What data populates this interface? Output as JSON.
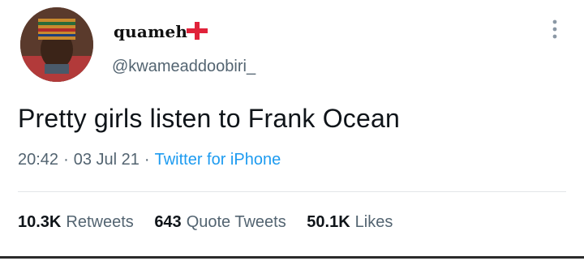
{
  "user": {
    "display_name": "quameh",
    "handle": "@kwameaddoobiri_"
  },
  "tweet": {
    "text": "Pretty girls listen to Frank Ocean",
    "time": "20:42",
    "date": "03 Jul 21",
    "source": "Twitter for iPhone"
  },
  "stats": {
    "retweets_count": "10.3K",
    "retweets_label": "Retweets",
    "quotes_count": "643",
    "quotes_label": "Quote Tweets",
    "likes_count": "50.1K",
    "likes_label": "Likes"
  },
  "icons": {
    "flag": "england-flag-icon",
    "more": "more-options-icon"
  },
  "colors": {
    "source_link": "#1d9bf0",
    "secondary_text": "#536471",
    "flag_cross": "#e0223a"
  }
}
